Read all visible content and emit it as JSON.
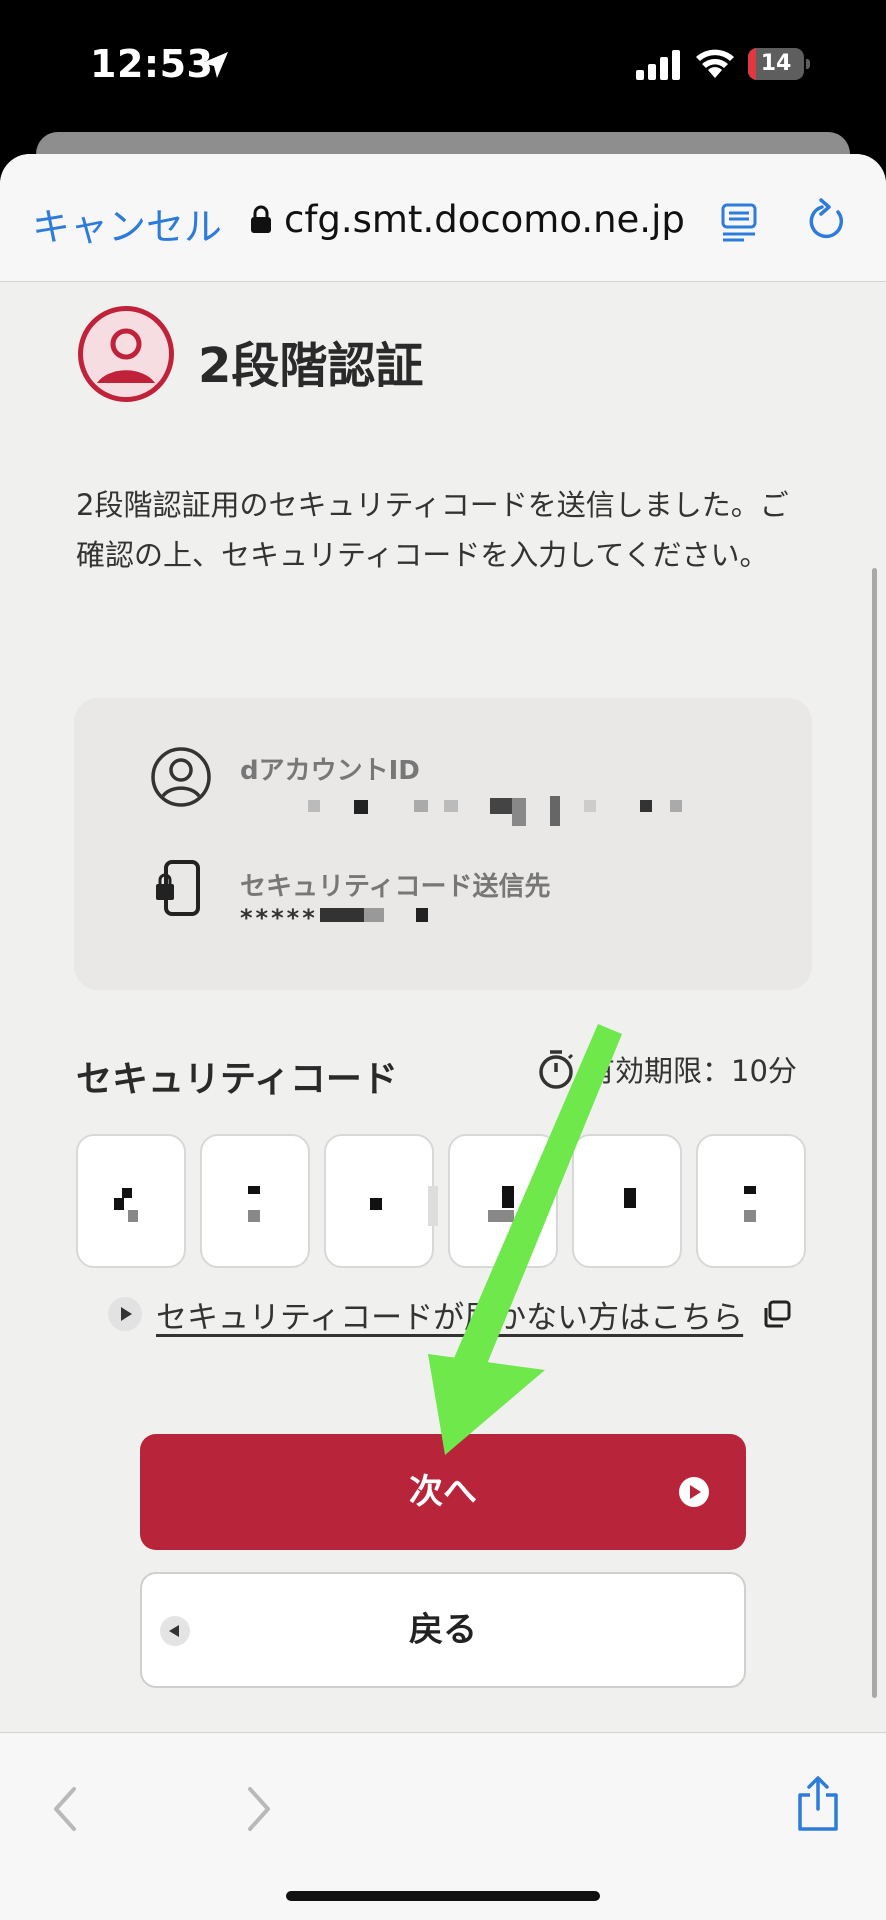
{
  "status_bar": {
    "time": "12:53",
    "battery_level": "14",
    "battery_fraction": 0.14
  },
  "browser": {
    "cancel_label": "キャンセル",
    "url": "cfg.smt.docomo.ne.jp",
    "accent_color": "#2d7cdb"
  },
  "page": {
    "title": "2段階認証",
    "description": "2段階認証用のセキュリティコードを送信しました。ご確認の上、セキュリティコードを入力してください。",
    "account": {
      "id_label": "dアカウントID",
      "send_to_label": "セキュリティコード送信先",
      "send_to_value": "*****"
    },
    "code": {
      "label": "セキュリティコード",
      "expire_label": "有効期限：10分",
      "digit_count": 6
    },
    "help_link": "セキュリティコードが届かない方はこちら",
    "next_button": "次へ",
    "back_button": "戻る",
    "brand_color": "#b8243a"
  },
  "icons": {
    "location": "location-arrow-icon",
    "signal": "cellular-signal-icon",
    "wifi": "wifi-icon",
    "lock": "lock-icon",
    "reader": "reader-mode-icon",
    "reload": "reload-icon",
    "user": "user-circle-icon",
    "phone": "smartphone-lock-icon",
    "timer": "stopwatch-icon",
    "copy": "external-window-icon",
    "share": "share-icon"
  },
  "annotation": {
    "arrow_color": "#6ee84a"
  }
}
